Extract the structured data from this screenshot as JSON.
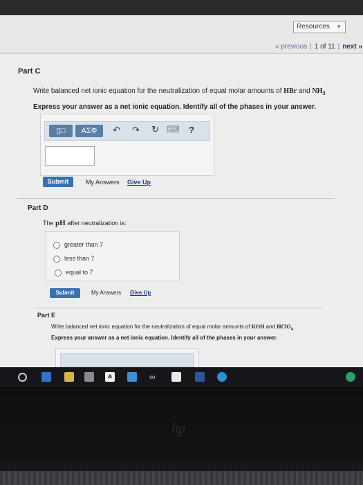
{
  "header": {
    "resources_label": "Resources",
    "previous_label": "« previous",
    "page_indicator": "1 of 11",
    "next_label": "next »"
  },
  "partC": {
    "title": "Part C",
    "question_prefix": "Write balanced net ionic equation for the neutralization of equal molar amounts of ",
    "formula1": "HBr",
    "question_mid": " and ",
    "formula2": "NH",
    "formula2_sub": "3",
    "instruction": "Express your answer as a net ionic equation. Identify all of the phases in your answer.",
    "toolbar": {
      "template_button": "▯□",
      "greek_button": "ΑΣΦ",
      "undo_icon": "↶",
      "redo_icon": "↷",
      "reset_icon": "↻",
      "keyboard_icon": "⌨",
      "help_icon": "?"
    },
    "submit_label": "Submit",
    "my_answers_label": "My Answers",
    "give_up_label": "Give Up"
  },
  "partD": {
    "title": "Part D",
    "question_prefix": "The ",
    "formula": "pH",
    "question_suffix": " after neutralization is:",
    "options": [
      "greater than 7",
      "less than 7",
      "equal to 7"
    ],
    "submit_label": "Submit",
    "my_answers_label": "My Answers",
    "give_up_label": "Give Up"
  },
  "partE": {
    "title": "Part E",
    "question_prefix": "Write balanced net ionic equation for the neutralization of equal molar amounts of ",
    "formula1": "KOH",
    "question_mid": " and ",
    "formula2": "HClO",
    "formula2_sub": "4",
    "instruction": "Express your answer as a net ionic equation. Identify all of the phases in your answer."
  },
  "taskbar": {
    "amazon_label": "a"
  },
  "bezel": {
    "brand": "hp"
  }
}
